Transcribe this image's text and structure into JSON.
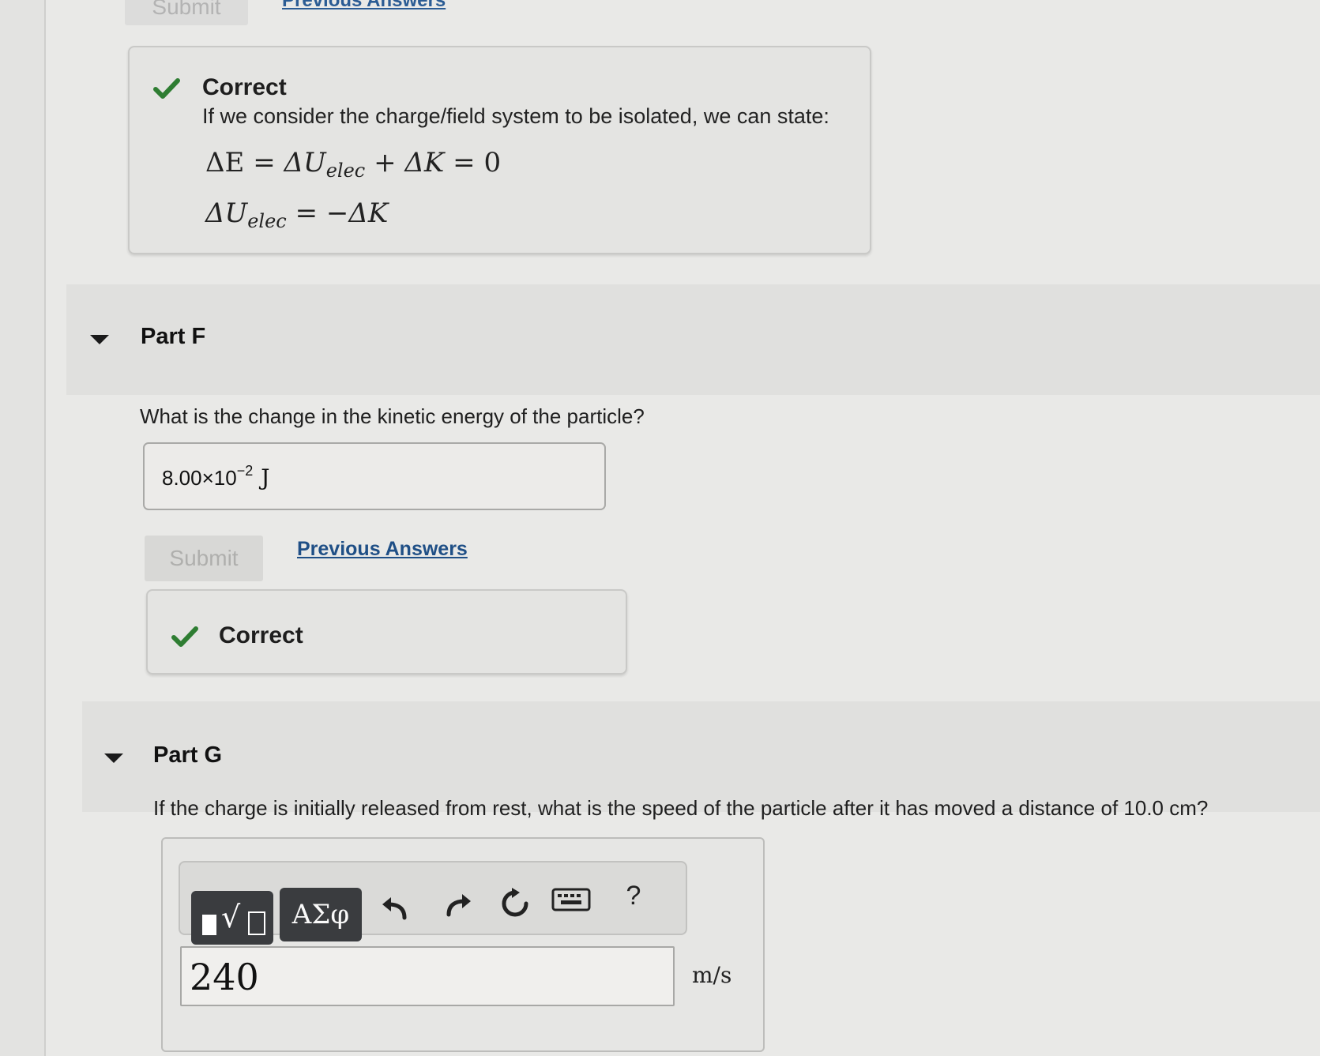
{
  "top": {
    "submit_label": "Submit",
    "previous_answers": "Previous Answers"
  },
  "part_e_feedback": {
    "status": "Correct",
    "text": "If we consider the charge/field system to be isolated, we can state:",
    "eq1": {
      "dE": "ΔE",
      "eq": "=",
      "dU": "ΔU",
      "sub": "elec",
      "plus": "+",
      "dK": "ΔK",
      "eq2": "=",
      "zero": "0"
    },
    "eq2": {
      "dU": "ΔU",
      "sub": "elec",
      "eq": "=",
      "rhs": "−ΔK"
    }
  },
  "part_f": {
    "title": "Part F",
    "question": "What is the change in the kinetic energy of the particle?",
    "answer": {
      "mantissa": "8.00×10",
      "exponent": "−2",
      "unit": "J"
    },
    "submit_label": "Submit",
    "previous_answers": "Previous Answers",
    "feedback": "Correct"
  },
  "part_g": {
    "title": "Part G",
    "question": "If the charge is initially released from rest, what is the speed of the particle after it has moved a distance of 10.0 cm?",
    "toolbar": {
      "templates_icon": "square-root-template-icon",
      "greek_label": "ΑΣφ",
      "undo_icon": "undo-icon",
      "redo_icon": "redo-icon",
      "reset_icon": "reset-icon",
      "keyboard_icon": "keyboard-icon",
      "help_label": "?"
    },
    "input_value": "240",
    "unit": "m/s"
  },
  "colors": {
    "check": "#2e7d32",
    "link": "#1f4f86",
    "toolbar_button": "#3a3c3f"
  }
}
